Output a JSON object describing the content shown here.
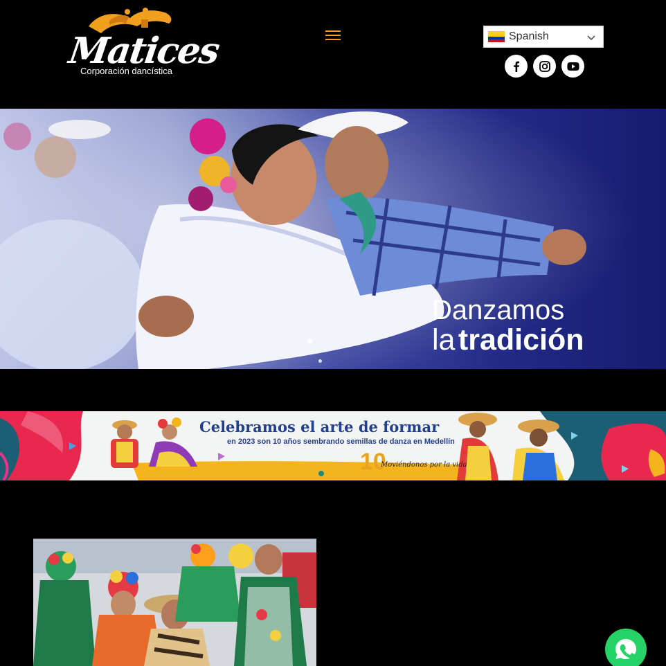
{
  "header": {
    "logo_script": "Matices",
    "logo_subtitle": "Corporación dancística",
    "menu_icon": "hamburger-icon",
    "language": {
      "selected": "Spanish",
      "flag": "colombia-flag",
      "chevron_icon": "chevron-down-icon"
    },
    "social": [
      {
        "name": "facebook",
        "icon": "facebook-icon"
      },
      {
        "name": "instagram",
        "icon": "instagram-icon"
      },
      {
        "name": "youtube",
        "icon": "youtube-icon"
      }
    ]
  },
  "hero": {
    "title_line1": "Danzamos",
    "title_line2_regular": "la",
    "title_line2_bold": "tradición",
    "slides_count": 2,
    "active_slide": 1
  },
  "banner": {
    "title": "Celebramos el arte de formar",
    "subtitle": "en 2023 son 10 años sembrando semillas de danza en Medellín",
    "years": "10",
    "slogan": "Moviéndonos por la vida"
  },
  "whatsapp": {
    "icon": "whatsapp-icon"
  },
  "colors": {
    "accent": "#f0a01e",
    "background": "#000000",
    "hero_blue": "#222a86",
    "banner_blue": "#23408e",
    "whatsapp_green": "#25d366"
  }
}
